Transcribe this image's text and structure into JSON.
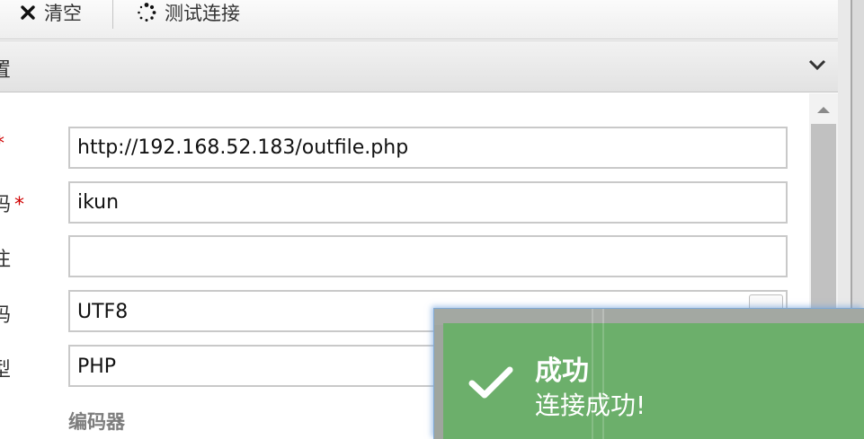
{
  "toolbar": {
    "clear_label": "清空",
    "test_label": "测试连接",
    "clear_icon": "close-x-icon",
    "test_icon": "spinner-dots-icon"
  },
  "panel": {
    "title_partial": "置",
    "toggle_icon": "chevron-down-icon"
  },
  "form": {
    "fields": [
      {
        "label_partial": "",
        "required": true,
        "value": "http://192.168.52.183/outfile.php"
      },
      {
        "label_partial": "码",
        "required": true,
        "value": "ikun"
      },
      {
        "label_partial": "注",
        "required": false,
        "value": ""
      },
      {
        "label_partial": "码",
        "required": false,
        "value": "UTF8",
        "type": "select"
      },
      {
        "label_partial": "型",
        "required": false,
        "value": "PHP",
        "type": "select"
      }
    ],
    "required_mark": "*",
    "section_label": "编码器"
  },
  "toast": {
    "title": "成功",
    "message": "连接成功!",
    "icon": "checkmark-icon",
    "color": "#6caf6b"
  },
  "colors": {
    "required": "#d00000",
    "toast_bg": "#6caf6b"
  }
}
